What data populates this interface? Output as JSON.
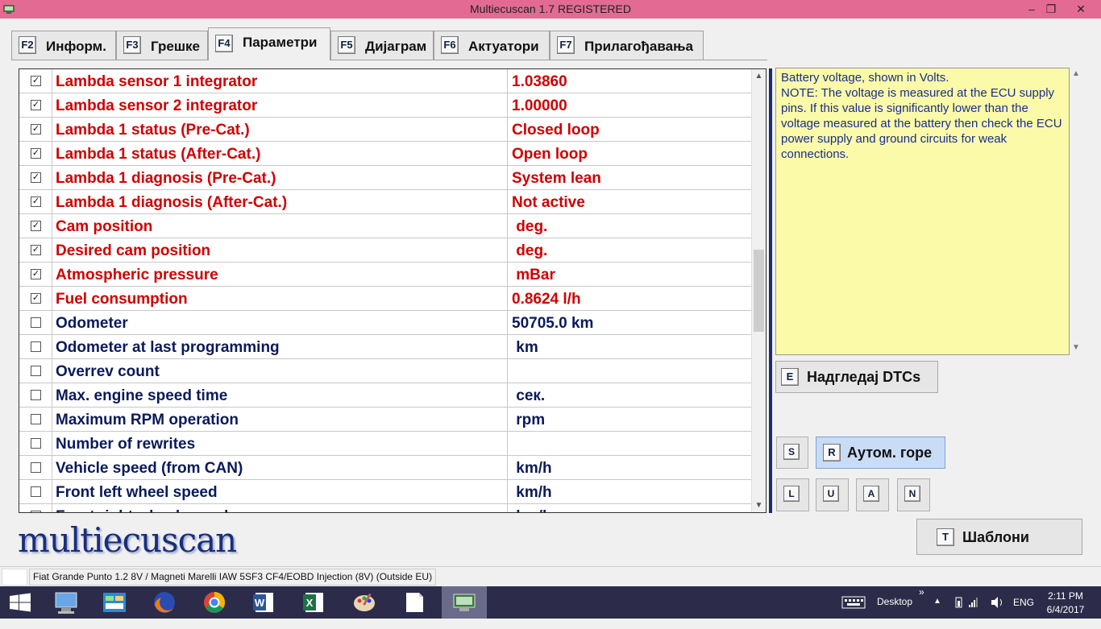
{
  "window": {
    "title": "Multiecuscan 1.7 REGISTERED",
    "minimize": "–",
    "maximize": "❐",
    "close": "✕"
  },
  "tabs": [
    {
      "key": "F2",
      "label": "Информ."
    },
    {
      "key": "F3",
      "label": "Грешке"
    },
    {
      "key": "F4",
      "label": "Параметри"
    },
    {
      "key": "F5",
      "label": "Дијаграм"
    },
    {
      "key": "F6",
      "label": "Актуатори"
    },
    {
      "key": "F7",
      "label": "Прилагођавања"
    }
  ],
  "active_tab": "Параметри",
  "parameters": [
    {
      "checked": true,
      "check": "✓",
      "name": "Lambda sensor 1 integrator",
      "value": "1.03860"
    },
    {
      "checked": true,
      "check": "✓",
      "name": "Lambda sensor 2 integrator",
      "value": "1.00000"
    },
    {
      "checked": true,
      "check": "✓",
      "name": "Lambda 1 status (Pre-Cat.)",
      "value": "Closed loop"
    },
    {
      "checked": true,
      "check": "✓",
      "name": "Lambda 1 status (After-Cat.)",
      "value": "Open loop"
    },
    {
      "checked": true,
      "check": "✓",
      "name": "Lambda 1 diagnosis (Pre-Cat.)",
      "value": "System lean"
    },
    {
      "checked": true,
      "check": "✓",
      "name": "Lambda 1 diagnosis (After-Cat.)",
      "value": "Not active"
    },
    {
      "checked": true,
      "check": "✓",
      "name": "Cam position",
      "value": " deg."
    },
    {
      "checked": true,
      "check": "✓",
      "name": "Desired cam position",
      "value": " deg."
    },
    {
      "checked": true,
      "check": "✓",
      "name": "Atmospheric pressure",
      "value": " mBar"
    },
    {
      "checked": true,
      "check": "✓",
      "name": "Fuel consumption",
      "value": "0.8624 l/h"
    },
    {
      "checked": false,
      "check": "",
      "name": "Odometer",
      "value": "50705.0 km"
    },
    {
      "checked": false,
      "check": "",
      "name": "Odometer at last programming",
      "value": " km"
    },
    {
      "checked": false,
      "check": "",
      "name": "Overrev count",
      "value": ""
    },
    {
      "checked": false,
      "check": "",
      "name": "Max. engine speed time",
      "value": " сек."
    },
    {
      "checked": false,
      "check": "",
      "name": "Maximum RPM operation",
      "value": " rpm"
    },
    {
      "checked": false,
      "check": "",
      "name": "Number of rewrites",
      "value": ""
    },
    {
      "checked": false,
      "check": "",
      "name": "Vehicle speed (from CAN)",
      "value": " km/h"
    },
    {
      "checked": false,
      "check": "",
      "name": "Front left wheel speed",
      "value": " km/h"
    },
    {
      "checked": false,
      "check": "",
      "name": "Front right wheel speed",
      "value": " km/h"
    }
  ],
  "scroll_position": 0.5,
  "help_text": "Battery voltage, shown in Volts.\nNOTE: The voltage is measured at the ECU supply pins. If this value is significantly lower than the voltage measured at the battery then check the ECU power supply and ground circuits for weak connections.",
  "buttons": {
    "dtc": {
      "key": "E",
      "label": "Надгледај DTCs"
    },
    "s": {
      "key": "S"
    },
    "auto_up": {
      "key": "R",
      "label": "Аутом. горе"
    },
    "l": {
      "key": "L"
    },
    "u": {
      "key": "U"
    },
    "a": {
      "key": "A"
    },
    "n": {
      "key": "N"
    },
    "templates": {
      "key": "T",
      "label": "Шаблони"
    }
  },
  "logo": "multiecuscan",
  "status_bar": "Fiat Grande Punto 1.2 8V / Magneti Marelli IAW 5SF3 CF4/EOBD Injection (8V) (Outside EU)",
  "taskbar": {
    "apps": [
      "start-icon",
      "computer-icon",
      "control-panel-icon",
      "firefox-icon",
      "chrome-icon",
      "word-icon",
      "excel-icon",
      "paint-icon",
      "notepad-icon",
      "multiecuscan-icon"
    ],
    "desktop_label": "Desktop",
    "lang": "ENG",
    "time": "2:11 PM",
    "date": "6/4/2017",
    "colors": {
      "taskbar": "#2c2c4a",
      "titlebar": "#e36b93",
      "active_param": "#d00000",
      "inactive_param": "#0a1a5a"
    }
  }
}
